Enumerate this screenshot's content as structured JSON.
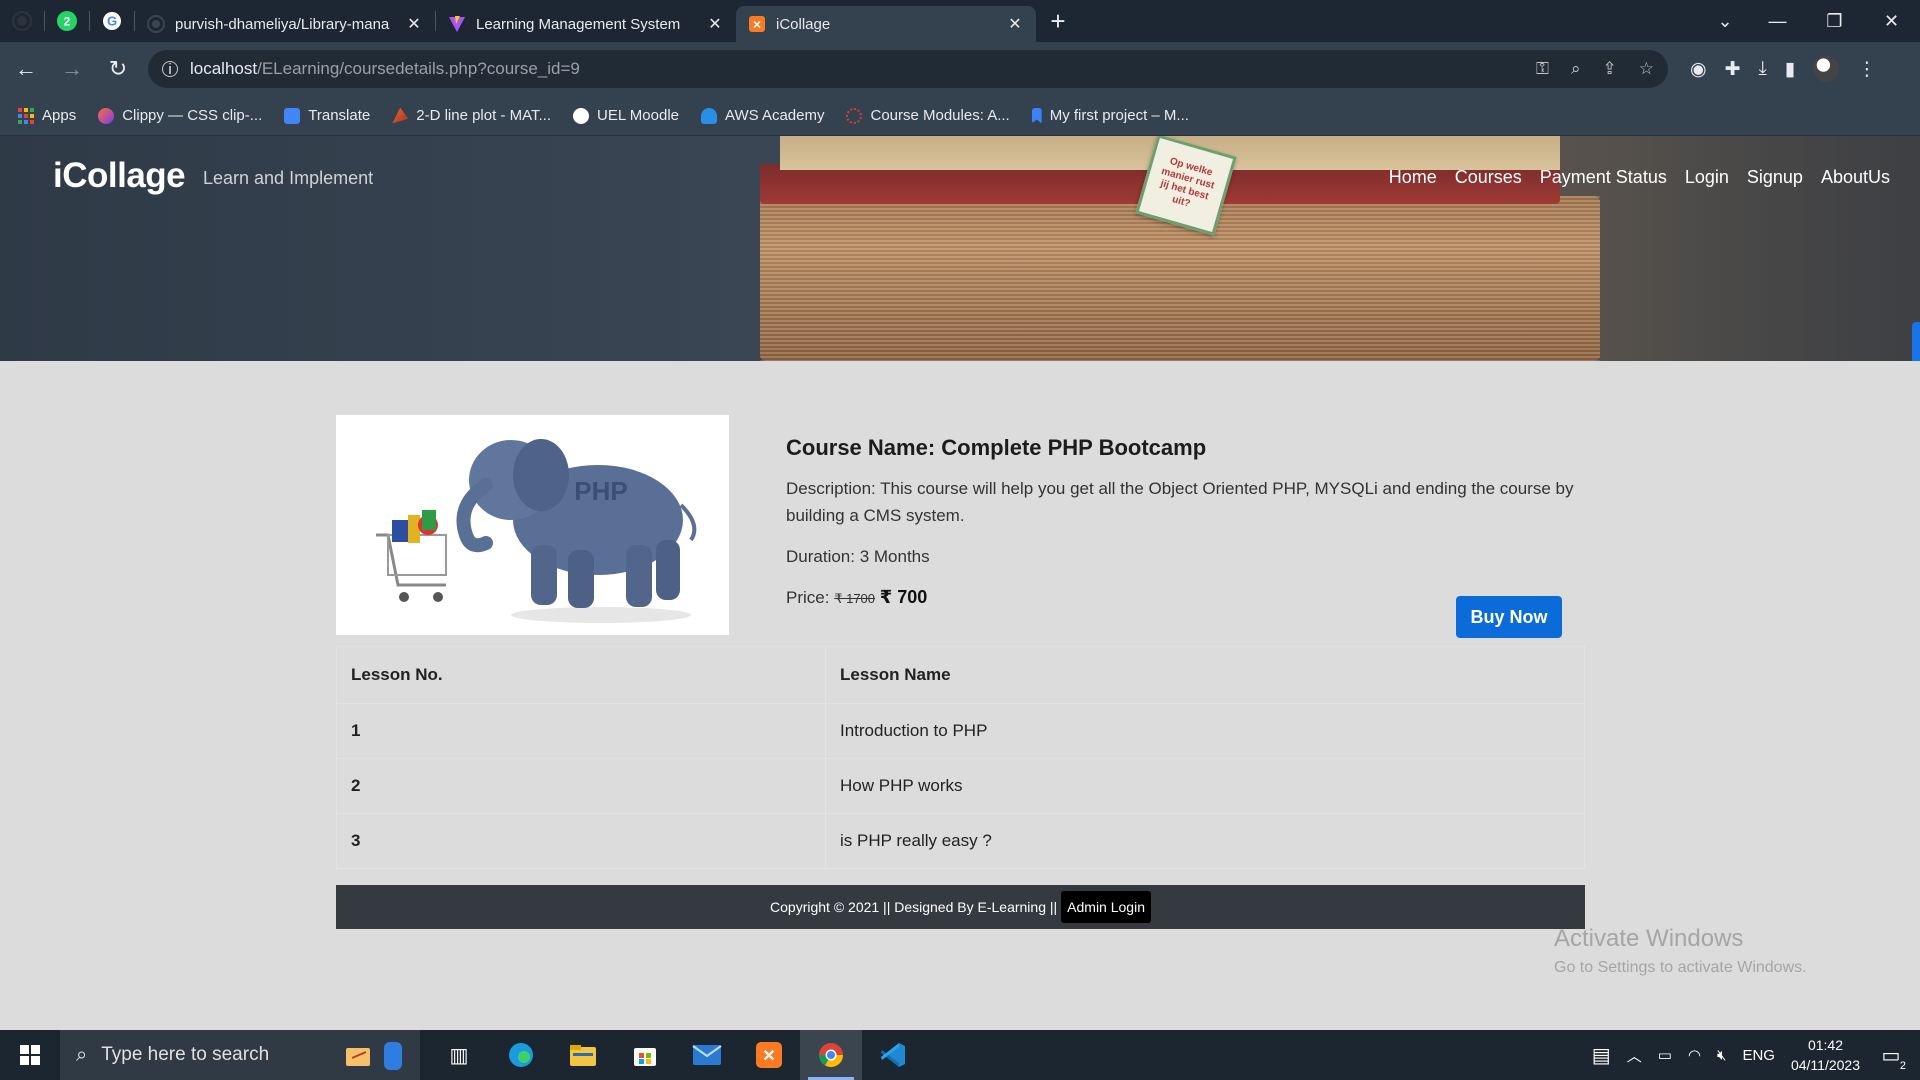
{
  "browser": {
    "pinned_tabs": [
      "github-icon",
      "whatsapp-icon",
      "google-icon"
    ],
    "whatsapp_badge": "2",
    "tabs": [
      {
        "title": "purvish-dhameliya/Library-mana",
        "icon": "github-icon"
      },
      {
        "title": "Learning Management System",
        "icon": "vite-icon"
      },
      {
        "title": "iCollage",
        "icon": "xampp-icon",
        "active": true
      }
    ],
    "new_tab_symbol": "+",
    "url_host": "localhost",
    "url_path": "/ELearning/coursedetails.php?course_id=9",
    "bookmarks": [
      {
        "label": "Apps",
        "icon": "apps-grid-icon",
        "color": "#e94235"
      },
      {
        "label": "Clippy — CSS clip-...",
        "icon": "clippy-icon",
        "color": "#ff6f3c"
      },
      {
        "label": "Translate",
        "icon": "translate-icon",
        "color": "#4285f4"
      },
      {
        "label": "2-D line plot - MAT...",
        "icon": "matlab-icon",
        "color": "#e16737"
      },
      {
        "label": "UEL Moodle",
        "icon": "moodle-icon",
        "color": "#ffffff"
      },
      {
        "label": "AWS Academy",
        "icon": "aws-cloud-icon",
        "color": "#2b8ee6"
      },
      {
        "label": "Course Modules: A...",
        "icon": "course-modules-icon",
        "color": "#e33b2e"
      },
      {
        "label": "My first project – M...",
        "icon": "bookmark-icon",
        "color": "#3b82f6"
      }
    ]
  },
  "site": {
    "brand": "iCollage",
    "tagline": "Learn and Implement",
    "nav": [
      "Home",
      "Courses",
      "Payment Status",
      "Login",
      "Signup",
      "AboutUs"
    ],
    "hero_note": "Op welke manier rust jij het best uit?"
  },
  "course": {
    "image_text": "PHP",
    "name": "Course Name: Complete PHP Bootcamp",
    "description": "Description: This course will help you get all the Object Oriented PHP, MYSQLi and ending the course by building a CMS system.",
    "duration": "Duration: 3 Months",
    "price_label": "Price:",
    "old_price": "₹ 1700",
    "new_price": "₹ 700",
    "buy_label": "Buy Now"
  },
  "lessons": {
    "headers": [
      "Lesson No.",
      "Lesson Name"
    ],
    "rows": [
      {
        "no": "1",
        "name": "Introduction to PHP"
      },
      {
        "no": "2",
        "name": "How PHP works"
      },
      {
        "no": "3",
        "name": "is PHP really easy ?"
      }
    ]
  },
  "footer": {
    "text": "Copyright © 2021 || Designed By E-Learning ||",
    "admin_label": "Admin Login"
  },
  "watermark": {
    "line1": "Activate Windows",
    "line2": "Go to Settings to activate Windows."
  },
  "taskbar": {
    "search_placeholder": "Type here to search",
    "apps": [
      "task-view-icon",
      "edge-icon",
      "file-explorer-icon",
      "microsoft-store-icon",
      "mail-icon",
      "xampp-icon",
      "chrome-icon",
      "vscode-icon"
    ],
    "language": "ENG",
    "time": "01:42",
    "date": "04/11/2023",
    "notification_count": "2"
  }
}
